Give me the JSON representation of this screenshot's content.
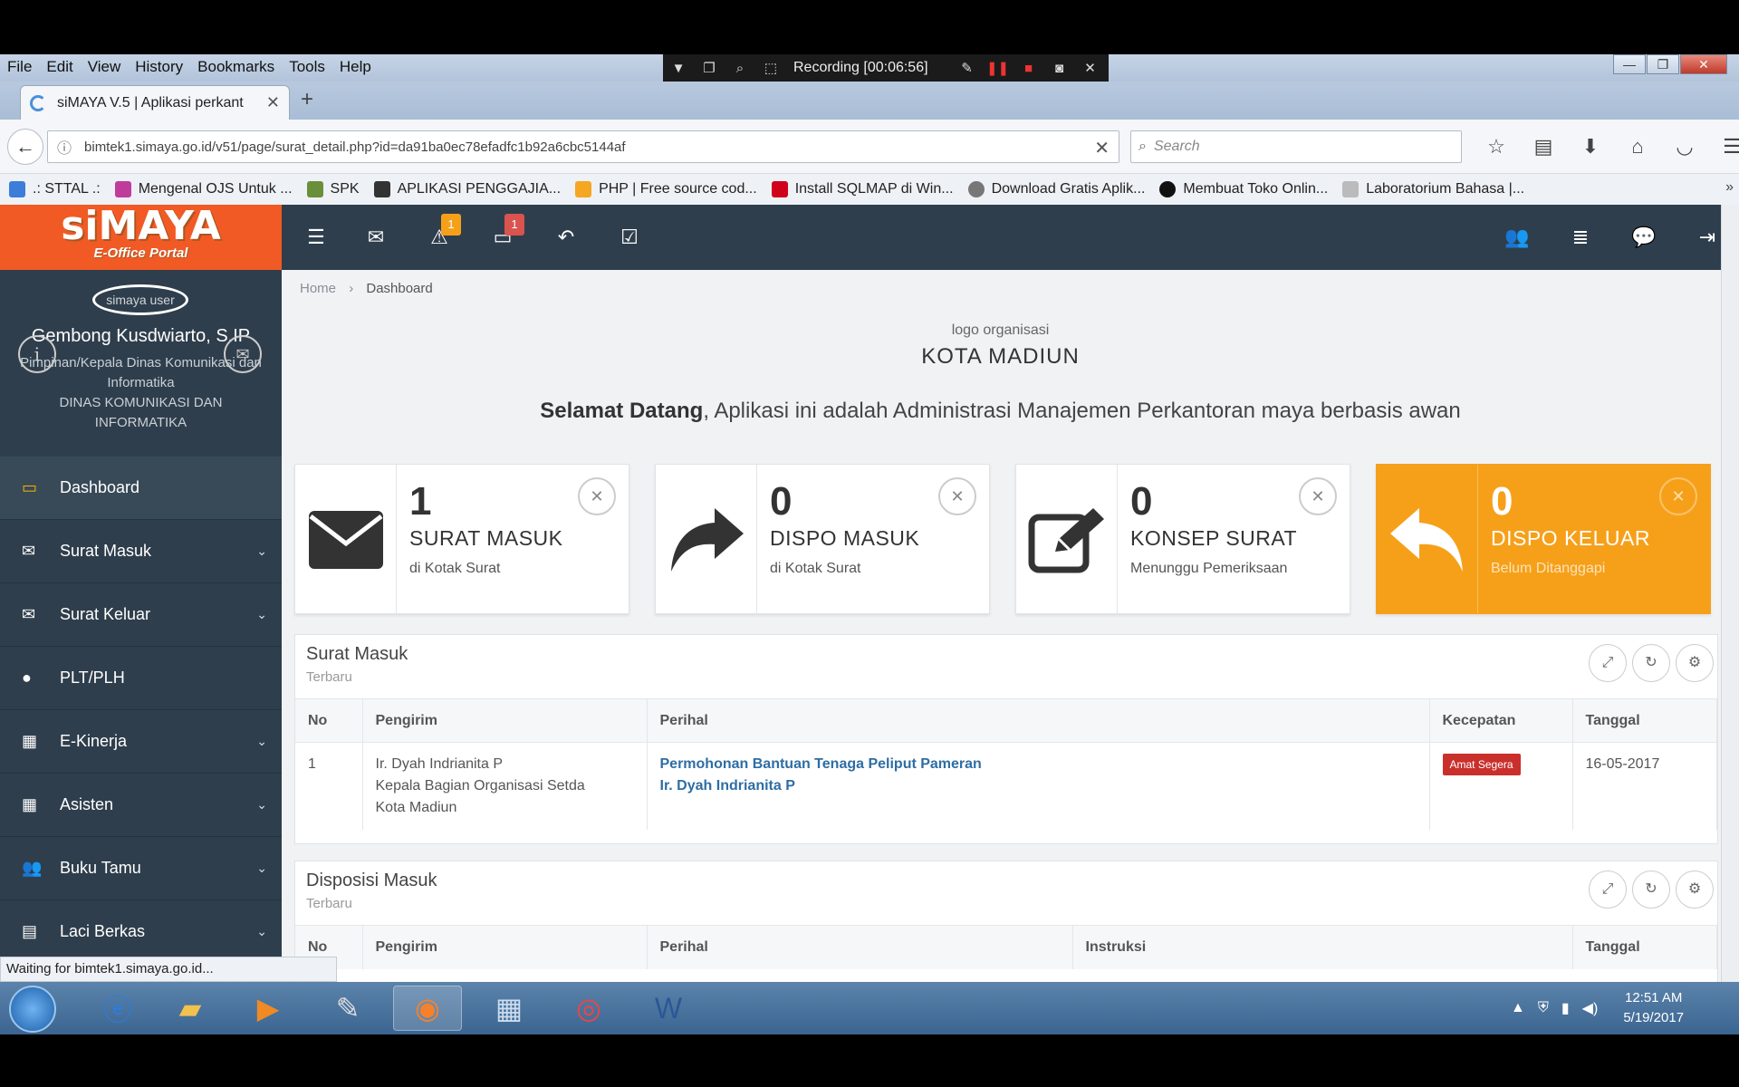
{
  "firefox": {
    "menu": [
      "File",
      "Edit",
      "View",
      "History",
      "Bookmarks",
      "Tools",
      "Help"
    ],
    "recording": "Recording [00:06:56]",
    "tab_title": "siMAYA V.5 | Aplikasi perkant",
    "url": "bimtek1.simaya.go.id/v51/page/surat_detail.php?id=da91ba0ec78efadfc1b92a6cbc5144af",
    "search_placeholder": "Search",
    "bookmarks": [
      {
        "label": ".: STTAL .:",
        "color": "#3b7dd8"
      },
      {
        "label": "Mengenal OJS Untuk ...",
        "color": "#c03c9a"
      },
      {
        "label": "SPK",
        "color": "#6a8f3a"
      },
      {
        "label": "APLIKASI PENGGAJIA...",
        "color": "#333333"
      },
      {
        "label": "PHP | Free source cod...",
        "color": "#f5a623"
      },
      {
        "label": "Install SQLMAP di Win...",
        "color": "#d0021b"
      },
      {
        "label": "Download Gratis Aplik...",
        "color": "#777777"
      },
      {
        "label": "Membuat Toko Onlin...",
        "color": "#111111"
      },
      {
        "label": "Laboratorium Bahasa |...",
        "color": "#bbbbbb"
      }
    ],
    "status": "Waiting for bimtek1.simaya.go.id..."
  },
  "app": {
    "logo_main": "siMAYA",
    "logo_sub": "E-Office Portal",
    "badges": {
      "alerts": "1",
      "inbox": "1"
    },
    "profile": {
      "avatar_text": "simaya user",
      "name": "Gembong Kusdwiarto, S.IP",
      "role": "Pimpinan/Kepala Dinas Komunikasi dan Informatika",
      "unit": "DINAS KOMUNIKASI DAN INFORMATIKA"
    },
    "menu": [
      {
        "label": "Dashboard",
        "icon": "monitor-icon"
      },
      {
        "label": "Surat Masuk",
        "icon": "envelope-icon"
      },
      {
        "label": "Surat Keluar",
        "icon": "envelope-outline-icon"
      },
      {
        "label": "PLT/PLH",
        "icon": "user-icon"
      },
      {
        "label": "E-Kinerja",
        "icon": "calendar-icon"
      },
      {
        "label": "Asisten",
        "icon": "calendar-icon"
      },
      {
        "label": "Buku Tamu",
        "icon": "users-icon"
      },
      {
        "label": "Laci Berkas",
        "icon": "file-icon"
      }
    ],
    "breadcrumb": {
      "home": "Home",
      "current": "Dashboard"
    },
    "org_logo_text": "logo organisasi",
    "org_name": "KOTA MADIUN",
    "welcome_bold": "Selamat Datang",
    "welcome_rest": ", Aplikasi ini adalah Administrasi Manajemen Perkantoran maya berbasis awan",
    "cards": [
      {
        "count": "1",
        "title": "SURAT MASUK",
        "subtitle": "di Kotak Surat"
      },
      {
        "count": "0",
        "title": "DISPO MASUK",
        "subtitle": "di Kotak Surat"
      },
      {
        "count": "0",
        "title": "KONSEP SURAT",
        "subtitle": "Menunggu Pemeriksaan"
      },
      {
        "count": "0",
        "title": "DISPO KELUAR",
        "subtitle": "Belum Ditanggapi"
      }
    ],
    "surat_masuk": {
      "title": "Surat Masuk",
      "subtitle": "Terbaru",
      "columns": [
        "No",
        "Pengirim",
        "Perihal",
        "Kecepatan",
        "Tanggal"
      ],
      "rows": [
        {
          "no": "1",
          "sender_name": "Ir. Dyah Indrianita P",
          "sender_pos": "Kepala Bagian Organisasi Setda",
          "sender_city": "Kota Madiun",
          "subject": "Permohonan Bantuan Tenaga Peliput Pameran",
          "subject_by": "Ir. Dyah Indrianita P",
          "speed": "Amat Segera",
          "date": "16-05-2017"
        }
      ]
    },
    "disposisi_masuk": {
      "title": "Disposisi Masuk",
      "subtitle": "Terbaru",
      "columns": [
        "No",
        "Pengirim",
        "Perihal",
        "Instruksi",
        "Tanggal"
      ]
    }
  },
  "taskbar": {
    "time": "12:51 AM",
    "date": "5/19/2017"
  }
}
